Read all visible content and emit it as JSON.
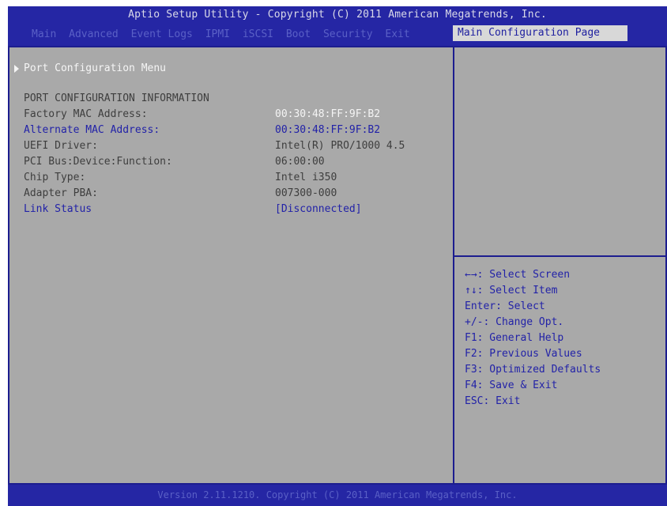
{
  "header": {
    "title": "Aptio Setup Utility - Copyright (C) 2011 American Megatrends, Inc.",
    "tabs": [
      "Main",
      "Advanced",
      "Event Logs",
      "IPMI",
      "iSCSI",
      "Boot",
      "Security",
      "Exit"
    ],
    "active_tab": "Main Configuration Page"
  },
  "main": {
    "submenu": "Port Configuration Menu",
    "section_title": "PORT CONFIGURATION INFORMATION",
    "rows": [
      {
        "label": "Factory MAC Address:",
        "value": "00:30:48:FF:9F:B2"
      },
      {
        "label": "Alternate MAC Address:",
        "value": "00:30:48:FF:9F:B2"
      },
      {
        "label": "UEFI Driver:",
        "value": "Intel(R) PRO/1000 4.5"
      },
      {
        "label": "PCI Bus:Device:Function:",
        "value": "06:00:00"
      },
      {
        "label": "Chip Type:",
        "value": "Intel i350"
      },
      {
        "label": "Adapter PBA:",
        "value": "007300-000"
      },
      {
        "label": "Link Status",
        "value": "[Disconnected]"
      }
    ]
  },
  "help": [
    "←→: Select Screen",
    "↑↓: Select Item",
    "Enter: Select",
    "+/-: Change Opt.",
    "F1: General Help",
    "F2: Previous Values",
    "F3: Optimized Defaults",
    "F4: Save & Exit",
    "ESC: Exit"
  ],
  "footer": "Version 2.11.1210. Copyright (C) 2011 American Megatrends, Inc.",
  "colors": {
    "background": "#a9a9a9",
    "accent": "#2526a4"
  }
}
